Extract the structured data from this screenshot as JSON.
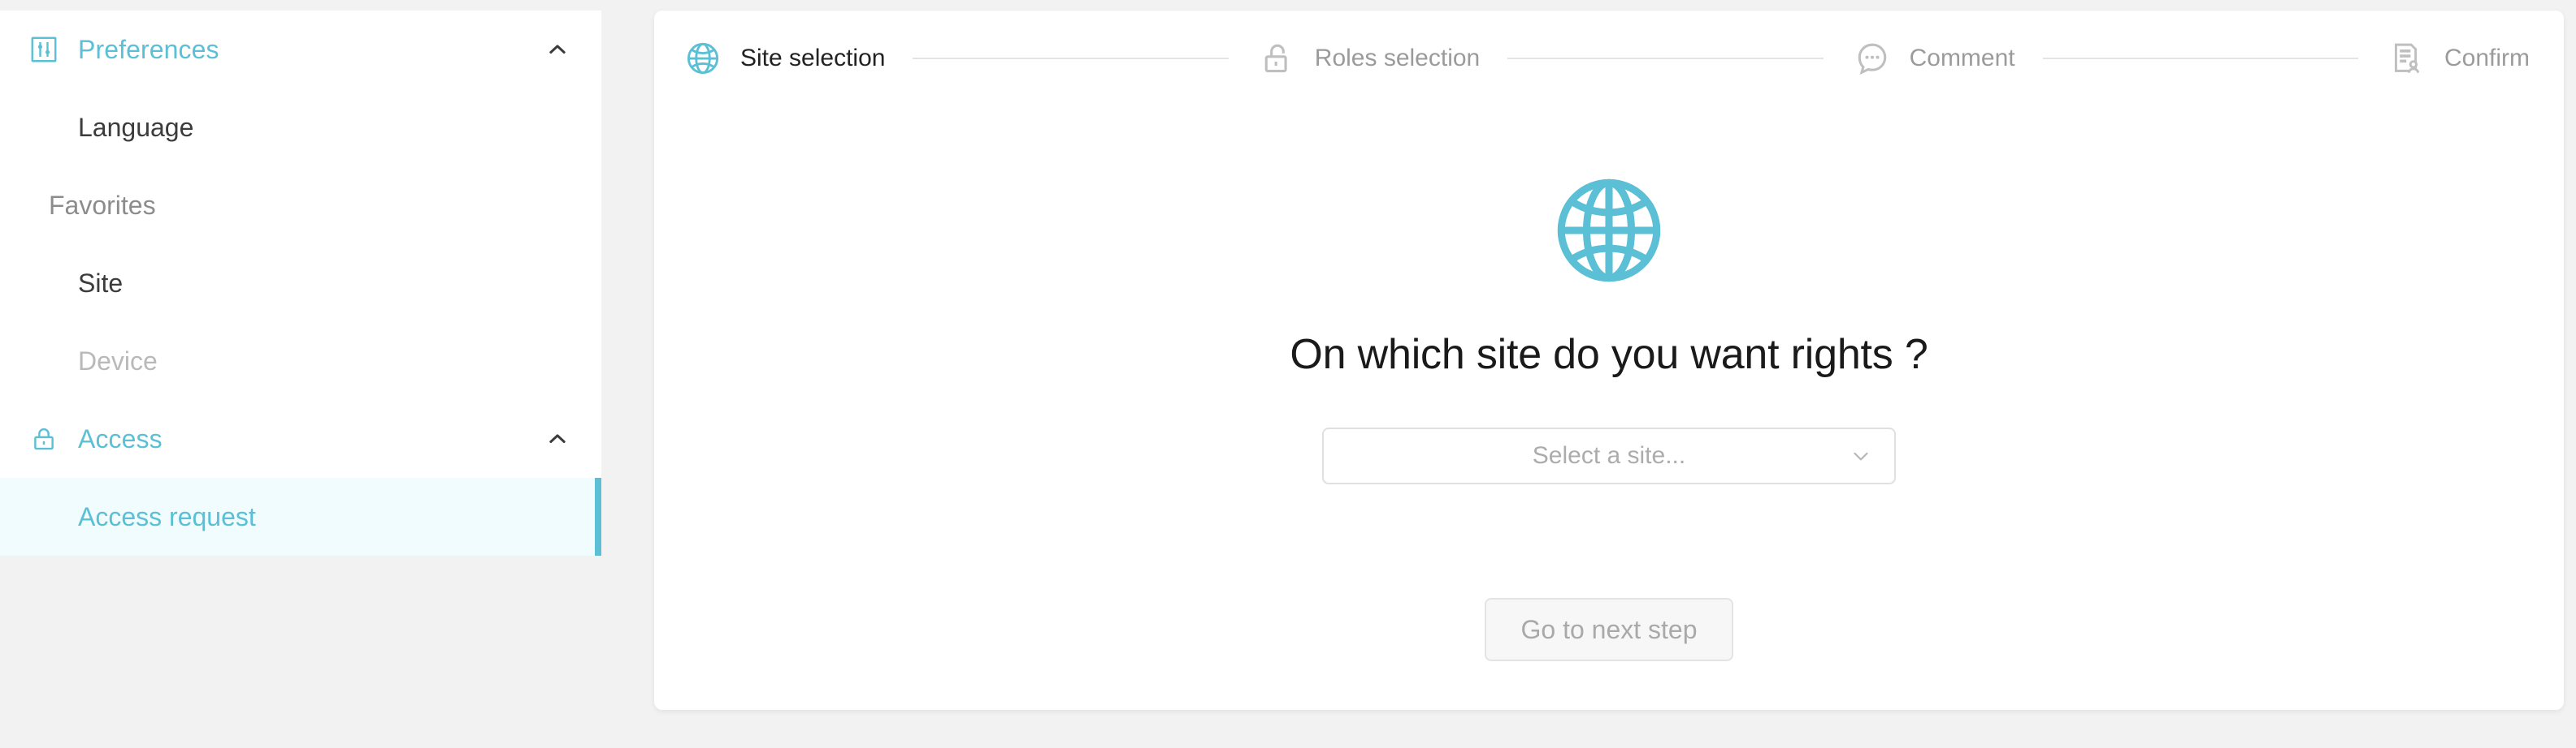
{
  "theme": {
    "accent": "#5bc0d6",
    "page_bg": "#f2f2f2",
    "panel_bg": "#ffffff",
    "active_item_bg": "#f0fcfd",
    "muted_text": "#b9b9b9",
    "body_text": "#3c3c3c"
  },
  "sidebar": {
    "groups": [
      {
        "label": "Preferences",
        "icon": "sliders-icon",
        "expanded": true,
        "chevron": "chevron-up-icon"
      },
      {
        "label": "Access",
        "icon": "lock-icon",
        "expanded": true,
        "chevron": "chevron-up-icon"
      }
    ],
    "preferences_items": [
      {
        "label": "Language",
        "state": "normal"
      }
    ],
    "favorites_section_label": "Favorites",
    "favorites_items": [
      {
        "label": "Site",
        "state": "normal"
      },
      {
        "label": "Device",
        "state": "muted"
      }
    ],
    "access_items": [
      {
        "label": "Access request",
        "state": "active"
      }
    ]
  },
  "stepper": {
    "steps": [
      {
        "label": "Site selection",
        "icon": "globe-icon",
        "state": "active"
      },
      {
        "label": "Roles selection",
        "icon": "unlock-icon",
        "state": "inactive"
      },
      {
        "label": "Comment",
        "icon": "comment-bubble-icon",
        "state": "inactive"
      },
      {
        "label": "Confirm",
        "icon": "document-user-icon",
        "state": "inactive"
      }
    ]
  },
  "main": {
    "hero_icon": "globe-icon",
    "heading": "On which site do you want rights ?",
    "site_select": {
      "value": "",
      "placeholder": "Select a site...",
      "chevron": "chevron-down-icon"
    },
    "next_button": {
      "label": "Go to next step",
      "disabled": true
    }
  }
}
